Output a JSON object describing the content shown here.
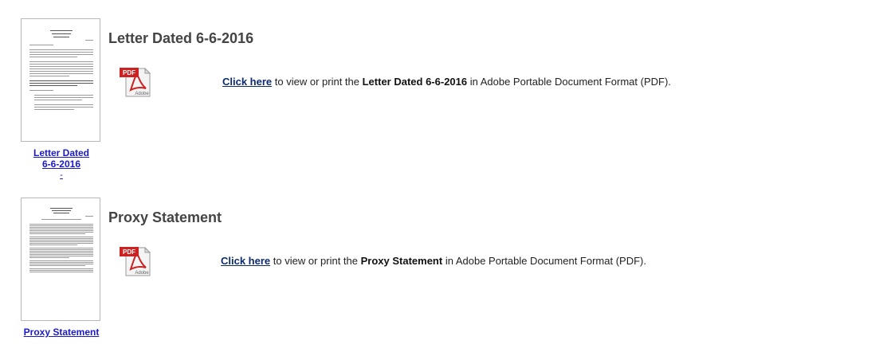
{
  "documents": [
    {
      "title": "Letter Dated 6-6-2016",
      "thumb_label_line1": "Letter Dated",
      "thumb_label_line2": "6-6-2016",
      "thumb_dash": "-",
      "click_here": "Click here",
      "text_middle": " to view or print the ",
      "doc_name": "Letter Dated 6-6-2016",
      "text_end": " in Adobe Portable Document Format (PDF)."
    },
    {
      "title": "Proxy Statement",
      "thumb_label": "Proxy Statement",
      "click_here": "Click here",
      "text_middle": " to view or print the ",
      "doc_name": "Proxy Statement",
      "text_end": " in Adobe Portable Document Format (PDF)."
    }
  ],
  "icons": {
    "pdf": "pdf-icon",
    "pdf_label": "PDF",
    "adobe_label": "Adobe"
  },
  "colors": {
    "link": "#1a1acc",
    "title": "#444444",
    "pdf_red": "#cc2222"
  }
}
